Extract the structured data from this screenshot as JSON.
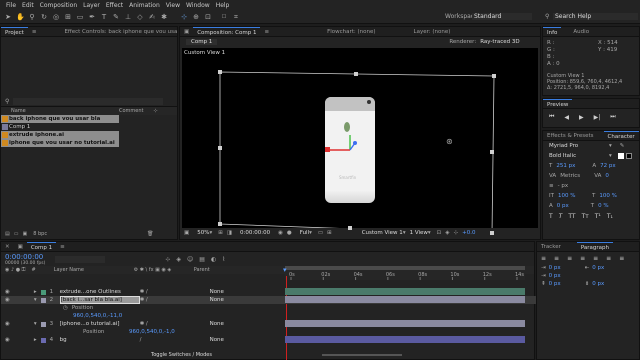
{
  "menu": [
    "File",
    "Edit",
    "Composition",
    "Layer",
    "Effect",
    "Animation",
    "View",
    "Window",
    "Help"
  ],
  "toolbar": {
    "workspace_label": "Workspace:",
    "workspace_value": "Standard",
    "search_help": "Search Help"
  },
  "project": {
    "tab_project": "Project",
    "tab_effect": "Effect Controls: back iphone que vou usar bla bla.ai",
    "col_name": "Name",
    "col_comment": "Comment",
    "items": [
      {
        "label": "back iphone que vou usar bla bla..ai",
        "type": "ai",
        "selected": true
      },
      {
        "label": "Comp 1",
        "type": "comp",
        "selected": false
      },
      {
        "label": "extrude iphone.ai",
        "type": "ai",
        "selected": true
      },
      {
        "label": "iphone que vou usar no tutorial.ai",
        "type": "ai",
        "selected": true
      }
    ],
    "bpc": "8 bpc"
  },
  "composition": {
    "tab_comp": "Composition: Comp 1",
    "tab_flow": "Flowchart: (none)",
    "tab_layer": "Layer: (none)",
    "comp_button": "Comp 1",
    "renderer_label": "Renderer:",
    "renderer_value": "Ray-traced 3D",
    "view_label": "Custom View 1",
    "phone_brand": "Smartfin",
    "footer": {
      "zoom": "50%",
      "time": "0:00:00:00",
      "quality": "Full",
      "view": "Custom View 1",
      "views": "1 View",
      "offset": "+0.0"
    }
  },
  "info": {
    "tab_info": "Info",
    "tab_audio": "Audio",
    "r": "R :",
    "g": "G :",
    "b": "B :",
    "a": "A : 0",
    "x": "X : 514",
    "y": "Y : 419",
    "cam_label": "Custom View 1",
    "position": "Position: 859,6, 760,4, 4612,4",
    "delta": "Δ: 2721,5, 964,0, 8192,4"
  },
  "preview": {
    "tab": "Preview"
  },
  "character": {
    "tab_effects": "Effects & Presets",
    "tab_char": "Character",
    "font": "Myriad Pro",
    "style": "Bold Italic",
    "size": "251 px",
    "leading": "72 px",
    "kern": "Metrics",
    "track": "0",
    "stroke_w": "- px",
    "vscale": "100 %",
    "hscale": "100 %",
    "baseline": "0 px",
    "tsume": "0 %"
  },
  "paragraph": {
    "tab_tracker": "Tracker",
    "tab_para": "Paragraph",
    "vals": [
      "0 px",
      "0 px",
      "0 px",
      "0 px",
      "0 px"
    ]
  },
  "timeline": {
    "tab": "Comp 1",
    "time": "0:00:00:00",
    "fps": "00000 (30.00 fps)",
    "col_layer": "Layer Name",
    "col_parent": "Parent",
    "ticks": [
      "0s",
      "02s",
      "04s",
      "06s",
      "08s",
      "10s",
      "12s",
      "14s"
    ],
    "layers": [
      {
        "num": "1",
        "name": "extrude...one Outlines",
        "parent": "None",
        "sub": false,
        "color": "#4a9a7a"
      },
      {
        "num": "2",
        "name": "[back i...sar bla bla.ai]",
        "parent": "None",
        "sub": false,
        "color": "#9a9ab0",
        "selected": true
      },
      {
        "num": "",
        "name": "Position",
        "parent": "",
        "sub": true,
        "value": "960,0,540,0,-11,0"
      },
      {
        "num": "3",
        "name": "[iphone...o tutorial.ai]",
        "parent": "None",
        "sub": false,
        "color": "#9a9ab0"
      },
      {
        "num": "",
        "name": "Position",
        "parent": "",
        "sub": true,
        "value": "960,0,540,0,-1,0"
      },
      {
        "num": "4",
        "name": "bg",
        "parent": "None",
        "sub": false,
        "color": "#6a6ab0"
      }
    ],
    "footer": "Toggle Switches / Modes"
  }
}
